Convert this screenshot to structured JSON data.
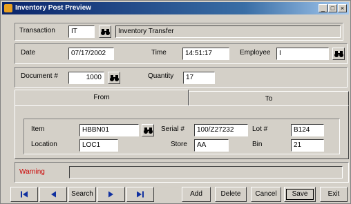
{
  "window": {
    "title": "Inventory Post Preview",
    "buttons": {
      "minimize": "_",
      "restore": "□",
      "close": "×"
    }
  },
  "header": {
    "transaction_label": "Transaction",
    "transaction_code": "IT",
    "transaction_desc": "Inventory Transfer",
    "date_label": "Date",
    "date_value": "07/17/2002",
    "time_label": "Time",
    "time_value": "14:51:17",
    "employee_label": "Employee",
    "employee_value": "I",
    "document_label": "Document #",
    "document_value": "1000",
    "quantity_label": "Quantity",
    "quantity_value": "17"
  },
  "tabs": [
    {
      "label": "From",
      "active": true
    },
    {
      "label": "To",
      "active": false
    }
  ],
  "from_panel": {
    "item_label": "Item",
    "item_value": "HBBN01",
    "serial_label": "Serial #",
    "serial_value": "100/Z27232",
    "lot_label": "Lot #",
    "lot_value": "B124",
    "location_label": "Location",
    "location_value": "LOC1",
    "store_label": "Store",
    "store_value": "AA",
    "bin_label": "Bin",
    "bin_value": "21"
  },
  "warning": {
    "label": "Warning",
    "value": "",
    "color": "#cc0000"
  },
  "toolbar": {
    "first_icon": "first-record-icon",
    "prev_icon": "previous-record-icon",
    "search_label": "Search",
    "next_icon": "next-record-icon",
    "last_icon": "last-record-icon",
    "add_label": "Add",
    "delete_label": "Delete",
    "cancel_label": "Cancel",
    "save_label": "Save",
    "exit_label": "Exit"
  },
  "colors": {
    "titlebar": "#0a246a",
    "nav_arrows": "#1030a0",
    "face": "#d4d0c8"
  }
}
